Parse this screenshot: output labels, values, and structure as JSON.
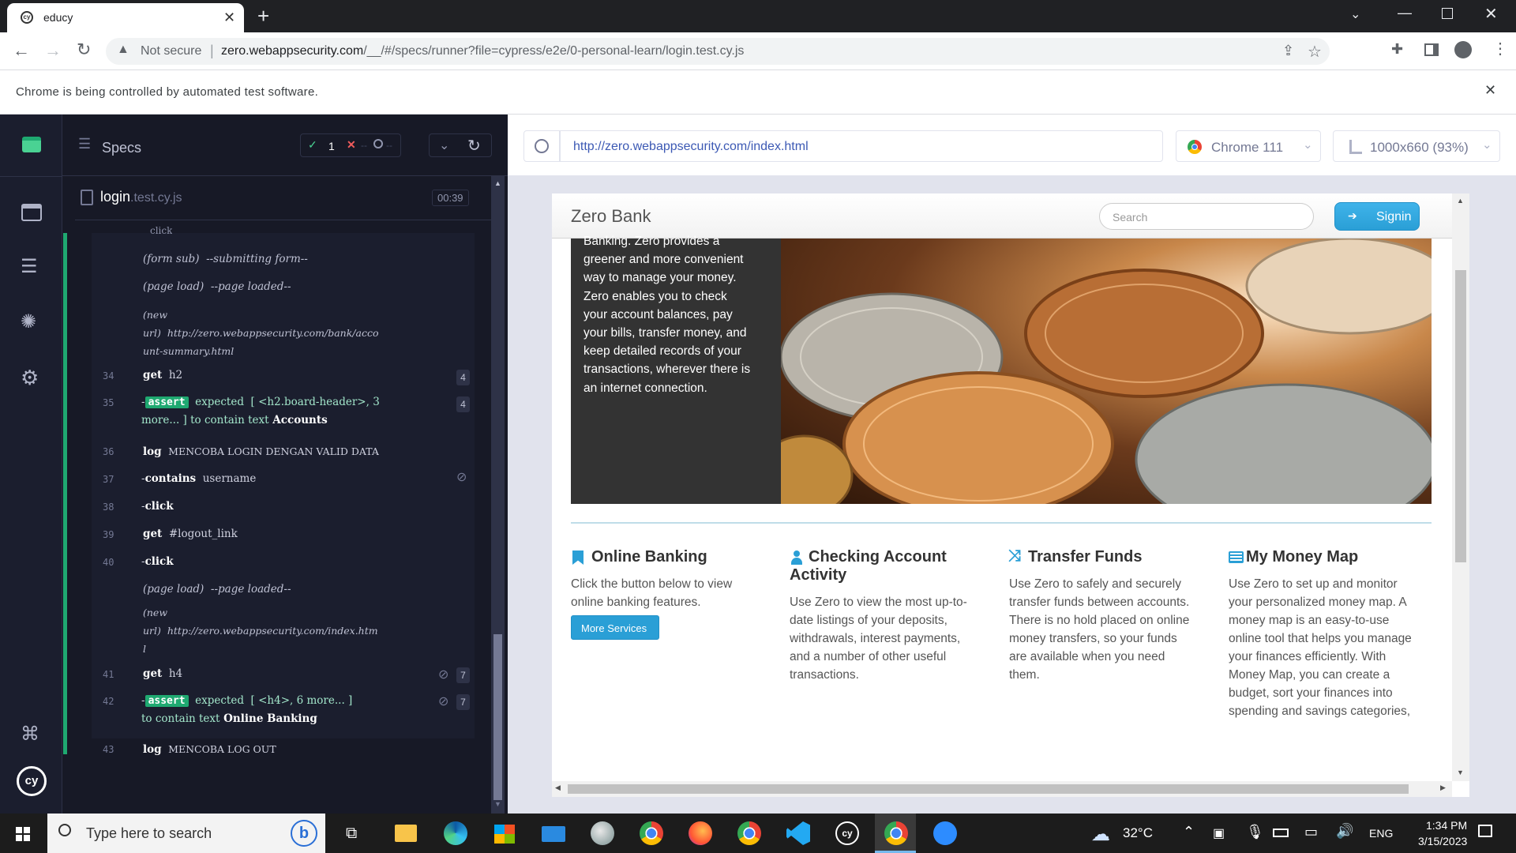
{
  "browser": {
    "tab_title": "educy",
    "not_secure_label": "Not secure",
    "url_host": "zero.webappsecurity.com",
    "url_path": "/__/#/specs/runner?file=cypress/e2e/0-personal-learn/login.test.cy.js",
    "infobar_text": "Chrome is being controlled by automated test software."
  },
  "reporter": {
    "specs_label": "Specs",
    "passed_count": "1",
    "failed_count": "--",
    "pending_count": "--",
    "spec_name": "login",
    "spec_ext": ".test.cy.js",
    "duration": "00:39",
    "top_partial": "click",
    "commands": [
      {
        "kind": "event",
        "name": "(form sub)",
        "msg": "--submitting form--"
      },
      {
        "kind": "event",
        "name": "(page load)",
        "msg": "--page loaded--"
      },
      {
        "kind": "event2",
        "name": "(new",
        "name2": "url)",
        "msg": "http://zero.webappsecurity.com/bank/acco",
        "msg2": "unt-summary.html"
      },
      {
        "kind": "cmd",
        "num": "34",
        "name": "get",
        "msg": "h2",
        "badge": "4"
      },
      {
        "kind": "assert",
        "num": "35",
        "name": "assert",
        "msg": "expected  [ <h2.board-header>, 3",
        "msg2a": "more... ] ",
        "msg2b": "to contain text",
        "msg2c": " Accounts",
        "badge": "4"
      },
      {
        "kind": "cmd",
        "num": "36",
        "name": "log",
        "msg": "MENCOBA LOGIN DENGAN VALID DATA"
      },
      {
        "kind": "child",
        "num": "37",
        "name": "contains",
        "msg": "username"
      },
      {
        "kind": "child",
        "num": "38",
        "name": "click",
        "msg": ""
      },
      {
        "kind": "cmd",
        "num": "39",
        "name": "get",
        "msg": "#logout_link"
      },
      {
        "kind": "child",
        "num": "40",
        "name": "click",
        "msg": ""
      },
      {
        "kind": "event",
        "name": "(page load)",
        "msg": "--page loaded--"
      },
      {
        "kind": "event2",
        "name": "(new",
        "name2": "url)",
        "msg": "http://zero.webappsecurity.com/index.htm",
        "msg2": "l"
      },
      {
        "kind": "cmd",
        "num": "41",
        "name": "get",
        "msg": "h4",
        "badge": "7"
      },
      {
        "kind": "assert",
        "num": "42",
        "name": "assert",
        "msg": "expected  [ <h4>, 6 more... ]",
        "msg2b": "to contain text",
        "msg2c": " Online Banking",
        "badge": "7"
      },
      {
        "kind": "cmd",
        "num": "43",
        "name": "log",
        "msg": "MENCOBA LOG OUT"
      }
    ]
  },
  "aut": {
    "url": "http://zero.webappsecurity.com/index.html",
    "browser_label": "Chrome 111",
    "viewport_label": "1000x660 (93%)"
  },
  "zero": {
    "brand": "Zero Bank",
    "search_placeholder": "Search",
    "signin_label": "Signin",
    "hero_lines": [
      "Banking. Zero provides a",
      "greener and more convenient",
      "way to manage your money.",
      "Zero enables you to check",
      "your account balances, pay",
      "your bills, transfer money, and",
      "keep detailed records of your",
      "transactions, wherever there is",
      "an internet connection."
    ],
    "features": [
      {
        "title": "Online Banking",
        "icon": "bookmark-icon",
        "lines": [
          "Click the button below to view",
          "online banking features."
        ],
        "button": "More Services"
      },
      {
        "title": "Checking Account",
        "title2": "Activity",
        "icon": "user-icon",
        "lines": [
          "Use Zero to view the most up-to-",
          "date listings of your deposits,",
          "withdrawals, interest payments,",
          "and a number of other useful",
          "transactions."
        ]
      },
      {
        "title": "Transfer Funds",
        "icon": "shuffle-icon",
        "lines": [
          "Use Zero to safely and securely",
          "transfer funds between accounts.",
          "There is no hold placed on online",
          "money transfers, so your funds",
          "are available when you need",
          "them."
        ]
      },
      {
        "title": "My Money Map",
        "icon": "list-icon",
        "lines": [
          "Use Zero to set up and monitor",
          "your personalized money map. A",
          "money map is an easy-to-use",
          "online tool that helps you manage",
          "your finances efficiently. With",
          "Money Map, you can create a",
          "budget, sort your finances into",
          "spending and savings categories,"
        ]
      }
    ]
  },
  "taskbar": {
    "search_placeholder": "Type here to search",
    "weather": "32°C",
    "language": "ENG",
    "time": "1:34 PM",
    "date": "3/15/2023"
  },
  "colors": {
    "cypress_green": "#1fa971",
    "zero_signin": "#2a9fd6",
    "chrome_dark": "#202124"
  }
}
